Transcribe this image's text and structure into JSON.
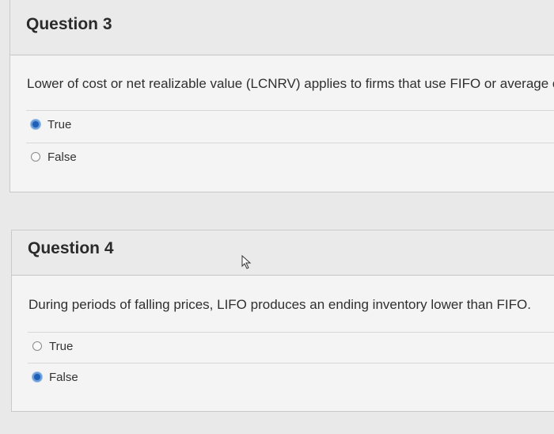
{
  "questions": [
    {
      "title": "Question 3",
      "text": "Lower of cost or net realizable value (LCNRV) applies to firms that use FIFO or average cos",
      "answers": [
        {
          "label": "True",
          "selected": true
        },
        {
          "label": "False",
          "selected": false
        }
      ]
    },
    {
      "title": "Question 4",
      "text": "During periods of falling prices, LIFO produces an ending inventory lower than FIFO.",
      "answers": [
        {
          "label": "True",
          "selected": false
        },
        {
          "label": "False",
          "selected": true
        }
      ]
    }
  ],
  "colors": {
    "accent": "#1f5fb8",
    "panel": "#f4f4f4"
  }
}
